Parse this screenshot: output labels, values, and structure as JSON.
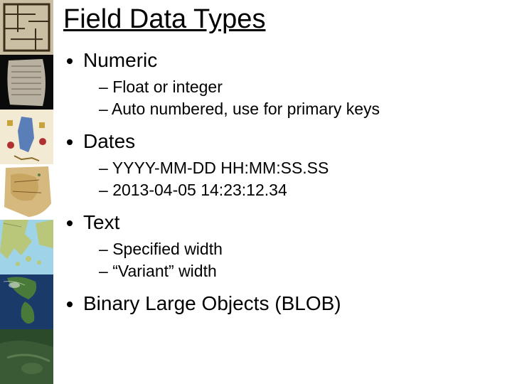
{
  "title": "Field Data Types",
  "bullets": {
    "numeric": {
      "label": "Numeric",
      "sub1": "Float or integer",
      "sub2": "Auto numbered, use for primary keys"
    },
    "dates": {
      "label": "Dates",
      "sub1": "YYYY-MM-DD HH:MM:SS.SS",
      "sub2": "2013-04-05 14:23:12.34"
    },
    "text": {
      "label": "Text",
      "sub1": "Specified width",
      "sub2": "“Variant” width"
    },
    "blob": {
      "label": "Binary Large Objects (BLOB)"
    }
  }
}
